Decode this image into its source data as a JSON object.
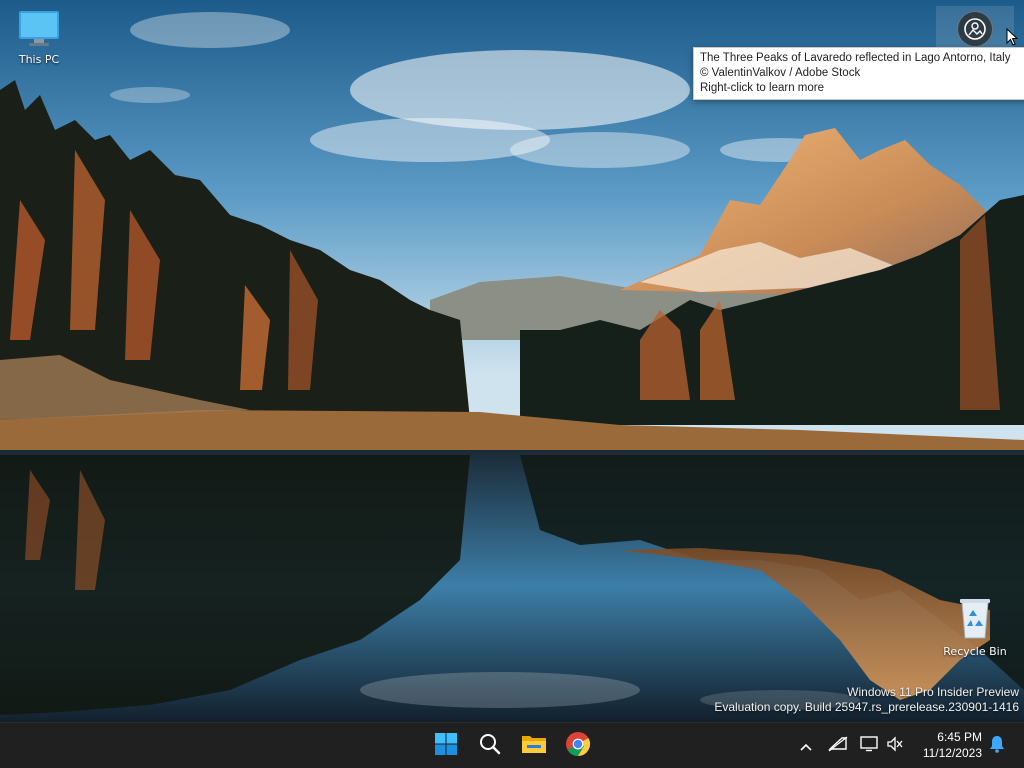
{
  "desktop": {
    "icons": [
      {
        "label": "This PC"
      },
      {
        "label": "Recycle Bin"
      }
    ]
  },
  "spotlight": {
    "tooltip": {
      "line1": "The Three Peaks of Lavaredo reflected in Lago Antorno, Italy",
      "line2": "© ValentinValkov / Adobe Stock",
      "line3": "Right-click to learn more"
    }
  },
  "watermark": {
    "line1": "Windows 11 Pro Insider Preview",
    "line2": "Evaluation copy. Build 25947.rs_prerelease.230901-1416"
  },
  "taskbar": {
    "apps": [
      "start-icon",
      "search-icon",
      "file-explorer-icon",
      "chrome-icon"
    ],
    "tray": [
      "chevron-up-icon",
      "network-icon",
      "display-icon",
      "volume-icon",
      "bell-icon"
    ],
    "clock": {
      "time": "6:45 PM",
      "date": "11/12/2023"
    }
  },
  "colors": {
    "taskbar_bg": "#202020",
    "accent": "#1e90ff"
  }
}
